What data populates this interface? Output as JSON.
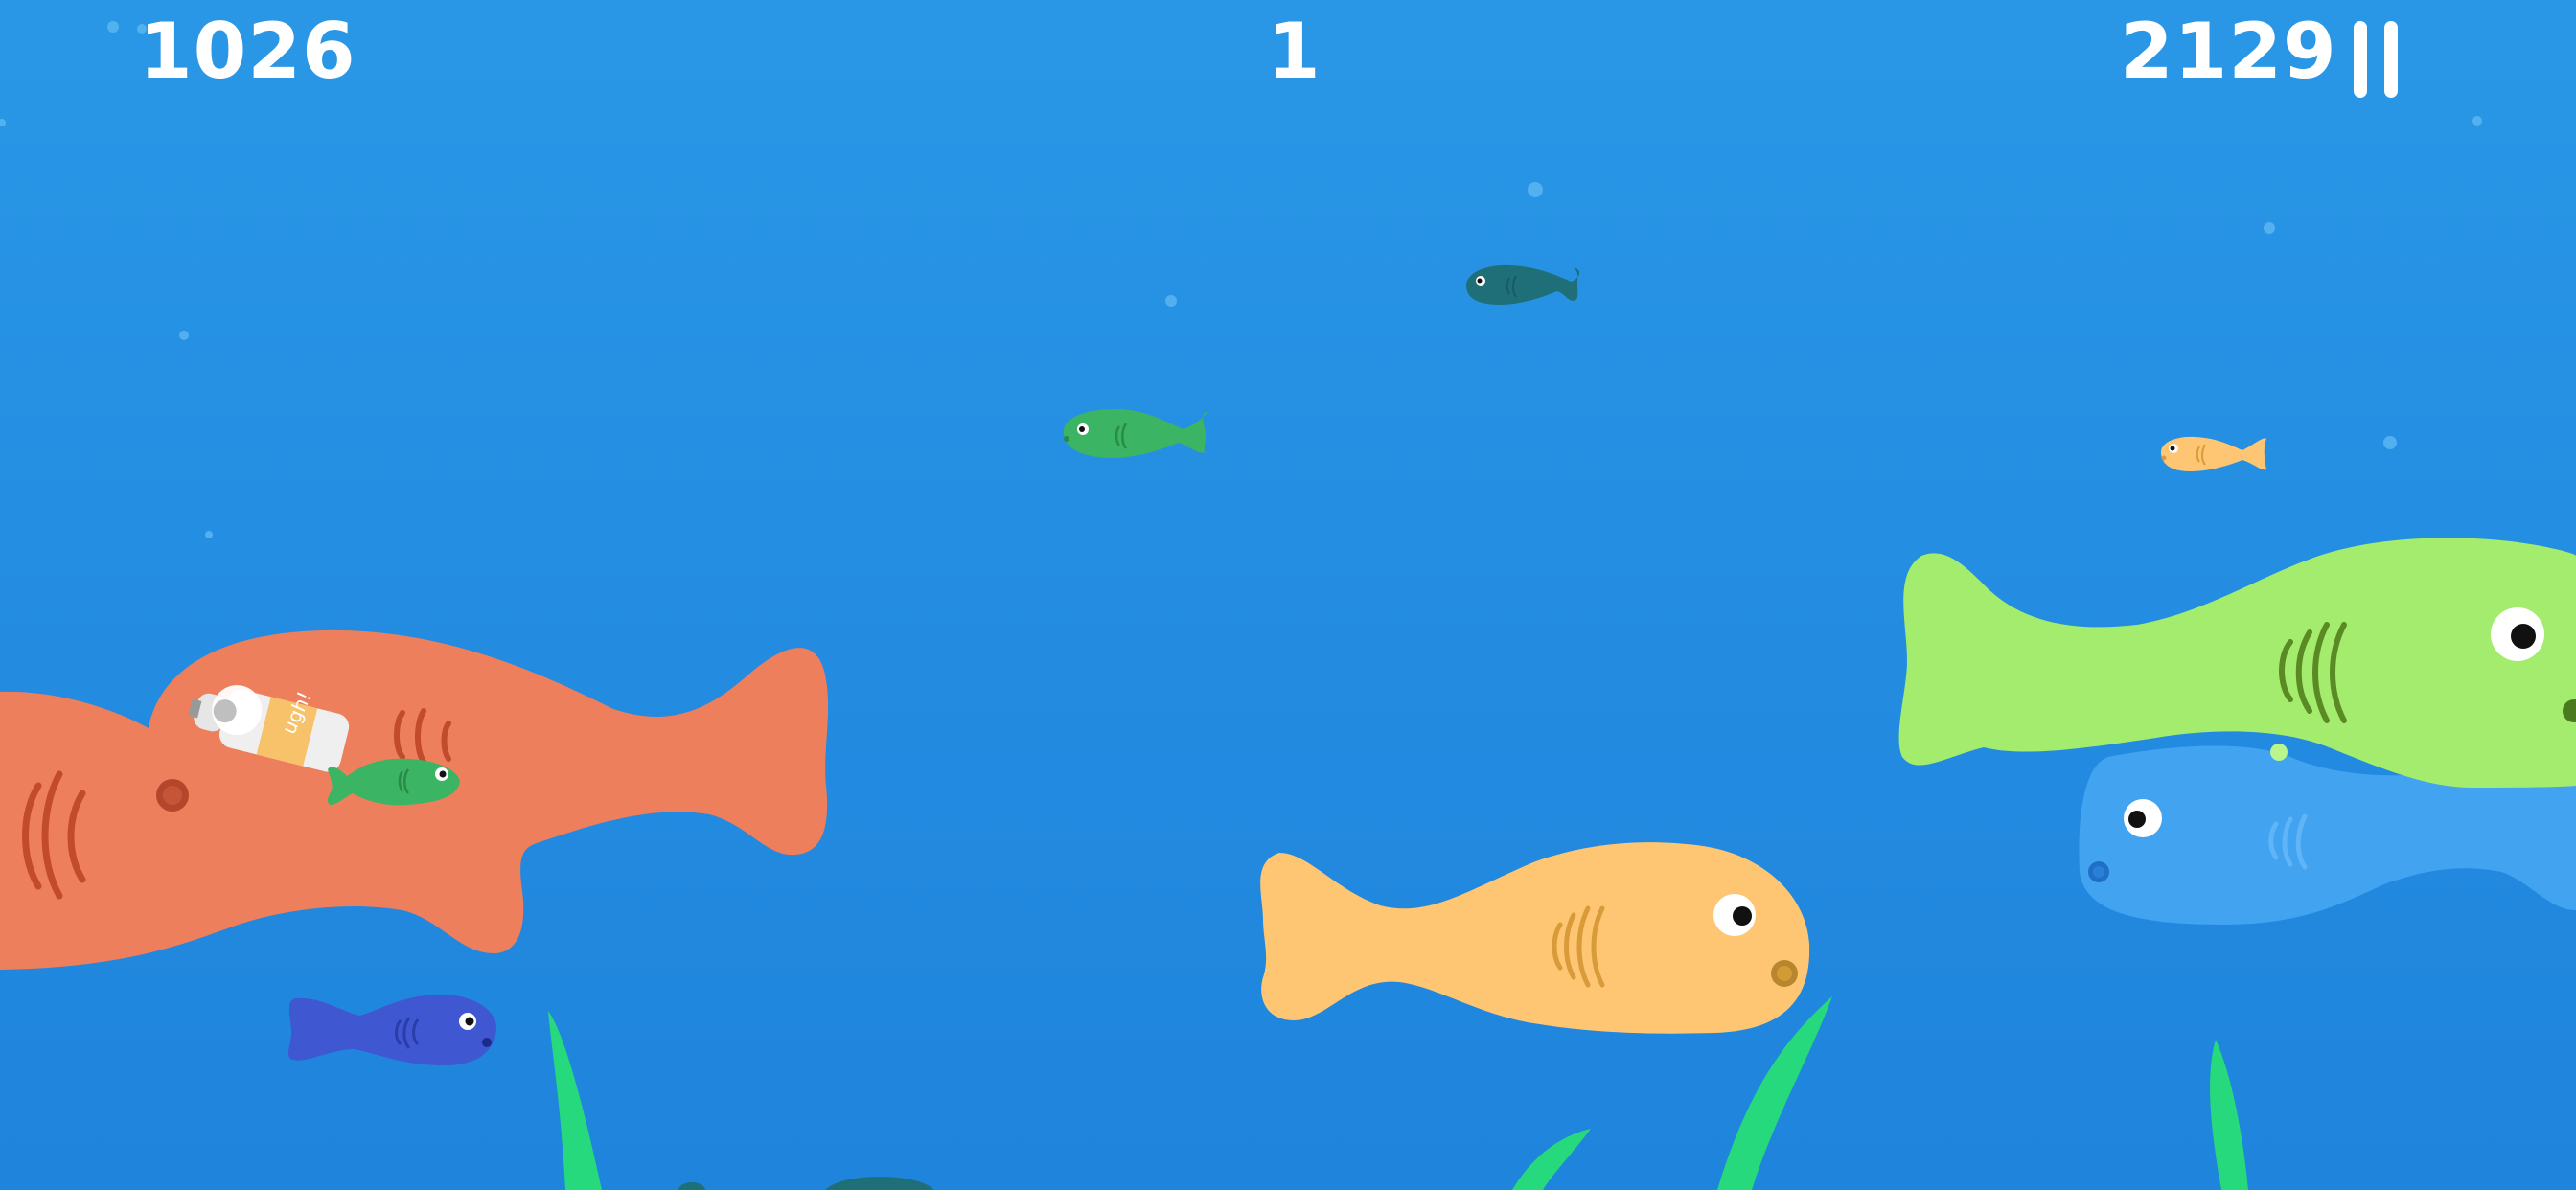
{
  "hud": {
    "score": "1026",
    "level": "1",
    "high_score": "2129"
  },
  "bottle": {
    "label": "ugh!"
  },
  "colors": {
    "water_top": "#2a97e6",
    "water_bottom": "#1f84dc",
    "coral_fish": "#ee7f5c",
    "lime_fish": "#a3ec6d",
    "light_blue_fish": "#42a3f0",
    "yellow_fish": "#fec673",
    "navy_fish": "#3f57d0",
    "green_fish": "#3bb464",
    "teal_fish": "#1f6f78",
    "seaweed": "#26d97c"
  },
  "icons": [
    "pause-icon",
    "bubble-icon",
    "plastic-bottle-icon"
  ]
}
